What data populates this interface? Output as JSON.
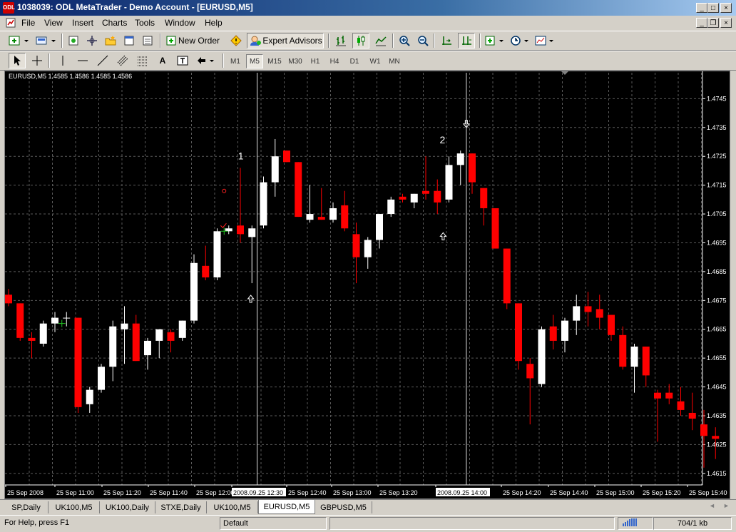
{
  "window": {
    "title": "1038039: ODL MetaTrader - Demo Account - [EURUSD,M5]",
    "app_icon_text": "ODL",
    "controls": [
      "_",
      "□",
      "×"
    ],
    "doc_controls": [
      "_",
      "❐",
      "×"
    ]
  },
  "menu": [
    "File",
    "View",
    "Insert",
    "Charts",
    "Tools",
    "Window",
    "Help"
  ],
  "toolbar1": {
    "new_order_label": "New Order",
    "expert_advisors_label": "Expert Advisors"
  },
  "timeframes": [
    "M1",
    "M5",
    "M15",
    "M30",
    "H1",
    "H4",
    "D1",
    "W1",
    "MN"
  ],
  "active_timeframe": "M5",
  "chart_data": {
    "type": "candlestick",
    "header": "EURUSD,M5  1.4585 1.4586 1.4585 1.4586",
    "symbol": "EURUSD",
    "timeframe": "M5",
    "last_ohlc": [
      1.4585,
      1.4586,
      1.4585,
      1.4586
    ],
    "ylim": [
      1.4611,
      1.4754
    ],
    "y_ticks": [
      "1.4745",
      "1.4735",
      "1.4725",
      "1.4715",
      "1.4705",
      "1.4695",
      "1.4685",
      "1.4675",
      "1.4665",
      "1.4655",
      "1.4645",
      "1.4635",
      "1.4625",
      "1.4615"
    ],
    "y_tick_values": [
      1.4745,
      1.4735,
      1.4725,
      1.4715,
      1.4705,
      1.4695,
      1.4685,
      1.4675,
      1.4665,
      1.4655,
      1.4645,
      1.4635,
      1.4625,
      1.4615
    ],
    "x_tick_labels": [
      "25 Sep 2008",
      "25 Sep 11:00",
      "25 Sep 11:20",
      "25 Sep 11:40",
      "25 Sep 12:00",
      "2008.09.25 12:30",
      "25 Sep 12:40",
      "25 Sep 13:00",
      "25 Sep 13:20",
      "2008.09.25 14:00",
      "25 Sep 14:20",
      "25 Sep 14:40",
      "25 Sep 15:00",
      "25 Sep 15:20",
      "25 Sep 15:40"
    ],
    "grid": true,
    "colors": {
      "background": "#000000",
      "bull": "#ffffff",
      "bear": "#ff0000",
      "grid": "#5a5a5a",
      "text": "#ffffff"
    },
    "candles": [
      {
        "o": 1.4677,
        "h": 1.4679,
        "l": 1.4673,
        "c": 1.4674
      },
      {
        "o": 1.4674,
        "h": 1.4674,
        "l": 1.4661,
        "c": 1.4662
      },
      {
        "o": 1.4662,
        "h": 1.4664,
        "l": 1.4655,
        "c": 1.4661
      },
      {
        "o": 1.466,
        "h": 1.4668,
        "l": 1.4659,
        "c": 1.4667
      },
      {
        "o": 1.4667,
        "h": 1.4671,
        "l": 1.4664,
        "c": 1.4669
      },
      {
        "o": 1.4669,
        "h": 1.4671,
        "l": 1.4666,
        "c": 1.4669
      },
      {
        "o": 1.4669,
        "h": 1.4669,
        "l": 1.4636,
        "c": 1.4638
      },
      {
        "o": 1.4639,
        "h": 1.4645,
        "l": 1.4636,
        "c": 1.4644
      },
      {
        "o": 1.4644,
        "h": 1.4653,
        "l": 1.4643,
        "c": 1.4652
      },
      {
        "o": 1.4652,
        "h": 1.4668,
        "l": 1.4647,
        "c": 1.4666
      },
      {
        "o": 1.4665,
        "h": 1.4673,
        "l": 1.4653,
        "c": 1.4667
      },
      {
        "o": 1.4667,
        "h": 1.467,
        "l": 1.4654,
        "c": 1.4654
      },
      {
        "o": 1.4656,
        "h": 1.4662,
        "l": 1.4651,
        "c": 1.4661
      },
      {
        "o": 1.4661,
        "h": 1.4665,
        "l": 1.4655,
        "c": 1.4665
      },
      {
        "o": 1.4664,
        "h": 1.4665,
        "l": 1.4657,
        "c": 1.4661
      },
      {
        "o": 1.4662,
        "h": 1.4668,
        "l": 1.4661,
        "c": 1.4668
      },
      {
        "o": 1.4668,
        "h": 1.4691,
        "l": 1.4667,
        "c": 1.4688
      },
      {
        "o": 1.4687,
        "h": 1.4694,
        "l": 1.4682,
        "c": 1.4683
      },
      {
        "o": 1.4683,
        "h": 1.47,
        "l": 1.4682,
        "c": 1.4699
      },
      {
        "o": 1.4699,
        "h": 1.4701,
        "l": 1.4698,
        "c": 1.47
      },
      {
        "o": 1.4701,
        "h": 1.4721,
        "l": 1.4695,
        "c": 1.4698
      },
      {
        "o": 1.4697,
        "h": 1.4701,
        "l": 1.4681,
        "c": 1.47
      },
      {
        "o": 1.4701,
        "h": 1.4718,
        "l": 1.47,
        "c": 1.4716
      },
      {
        "o": 1.4716,
        "h": 1.4731,
        "l": 1.4711,
        "c": 1.4725
      },
      {
        "o": 1.4727,
        "h": 1.4727,
        "l": 1.4723,
        "c": 1.4723
      },
      {
        "o": 1.4723,
        "h": 1.4723,
        "l": 1.4704,
        "c": 1.4704
      },
      {
        "o": 1.4703,
        "h": 1.4715,
        "l": 1.4702,
        "c": 1.4705
      },
      {
        "o": 1.4704,
        "h": 1.4714,
        "l": 1.4703,
        "c": 1.4703
      },
      {
        "o": 1.4703,
        "h": 1.4709,
        "l": 1.4702,
        "c": 1.4707
      },
      {
        "o": 1.4708,
        "h": 1.4713,
        "l": 1.4699,
        "c": 1.47
      },
      {
        "o": 1.4698,
        "h": 1.4702,
        "l": 1.4681,
        "c": 1.469
      },
      {
        "o": 1.469,
        "h": 1.4697,
        "l": 1.4686,
        "c": 1.4696
      },
      {
        "o": 1.4696,
        "h": 1.4705,
        "l": 1.4693,
        "c": 1.4705
      },
      {
        "o": 1.4705,
        "h": 1.4711,
        "l": 1.4704,
        "c": 1.471
      },
      {
        "o": 1.4711,
        "h": 1.4712,
        "l": 1.4709,
        "c": 1.471
      },
      {
        "o": 1.4709,
        "h": 1.4712,
        "l": 1.4707,
        "c": 1.4712
      },
      {
        "o": 1.4713,
        "h": 1.4725,
        "l": 1.471,
        "c": 1.4712
      },
      {
        "o": 1.4713,
        "h": 1.4717,
        "l": 1.4705,
        "c": 1.4709
      },
      {
        "o": 1.471,
        "h": 1.4725,
        "l": 1.4709,
        "c": 1.4722
      },
      {
        "o": 1.4722,
        "h": 1.4727,
        "l": 1.4715,
        "c": 1.4726
      },
      {
        "o": 1.4726,
        "h": 1.4726,
        "l": 1.4712,
        "c": 1.4716
      },
      {
        "o": 1.4714,
        "h": 1.4714,
        "l": 1.4701,
        "c": 1.4707
      },
      {
        "o": 1.4707,
        "h": 1.4707,
        "l": 1.4693,
        "c": 1.4693
      },
      {
        "o": 1.4693,
        "h": 1.4693,
        "l": 1.4672,
        "c": 1.4674
      },
      {
        "o": 1.4674,
        "h": 1.4674,
        "l": 1.4651,
        "c": 1.4654
      },
      {
        "o": 1.4653,
        "h": 1.4655,
        "l": 1.4632,
        "c": 1.4648
      },
      {
        "o": 1.4646,
        "h": 1.4666,
        "l": 1.4645,
        "c": 1.4665
      },
      {
        "o": 1.4666,
        "h": 1.467,
        "l": 1.4658,
        "c": 1.4661
      },
      {
        "o": 1.4661,
        "h": 1.4669,
        "l": 1.4657,
        "c": 1.4668
      },
      {
        "o": 1.4668,
        "h": 1.4677,
        "l": 1.4663,
        "c": 1.4673
      },
      {
        "o": 1.4673,
        "h": 1.4678,
        "l": 1.4666,
        "c": 1.4671
      },
      {
        "o": 1.4672,
        "h": 1.4677,
        "l": 1.4665,
        "c": 1.4669
      },
      {
        "o": 1.467,
        "h": 1.467,
        "l": 1.4661,
        "c": 1.4663
      },
      {
        "o": 1.4663,
        "h": 1.4666,
        "l": 1.4651,
        "c": 1.4652
      },
      {
        "o": 1.4652,
        "h": 1.466,
        "l": 1.4643,
        "c": 1.4659
      },
      {
        "o": 1.4659,
        "h": 1.4659,
        "l": 1.4645,
        "c": 1.4649
      },
      {
        "o": 1.4643,
        "h": 1.4644,
        "l": 1.4626,
        "c": 1.4641
      },
      {
        "o": 1.4643,
        "h": 1.4646,
        "l": 1.4639,
        "c": 1.4641
      },
      {
        "o": 1.464,
        "h": 1.4645,
        "l": 1.4635,
        "c": 1.4637
      },
      {
        "o": 1.4636,
        "h": 1.4643,
        "l": 1.463,
        "c": 1.4634
      },
      {
        "o": 1.4632,
        "h": 1.4637,
        "l": 1.4617,
        "c": 1.4628
      },
      {
        "o": 1.4628,
        "h": 1.4631,
        "l": 1.462,
        "c": 1.4627
      }
    ],
    "annotations": [
      "1",
      "2"
    ],
    "crosshair_labels": [
      "2008.09.25 12:30",
      "2008.09.25 14:00"
    ]
  },
  "tabs": [
    "SP,Daily",
    "UK100,M5",
    "UK100,Daily",
    "STXE,Daily",
    "UK100,M5",
    "EURUSD,M5",
    "GBPUSD,M5"
  ],
  "active_tab": 5,
  "tab_nav": [
    "◄",
    "►"
  ],
  "status": {
    "help_text": "For Help, press F1",
    "profile": "Default",
    "traffic": "704/1 kb"
  }
}
